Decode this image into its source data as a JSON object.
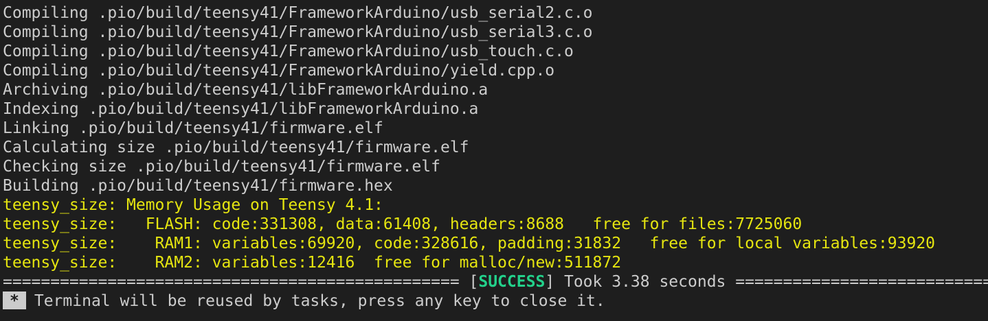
{
  "terminal": {
    "plain_lines": [
      "Compiling .pio/build/teensy41/FrameworkArduino/usb_serial2.c.o",
      "Compiling .pio/build/teensy41/FrameworkArduino/usb_serial3.c.o",
      "Compiling .pio/build/teensy41/FrameworkArduino/usb_touch.c.o",
      "Compiling .pio/build/teensy41/FrameworkArduino/yield.cpp.o",
      "Archiving .pio/build/teensy41/libFrameworkArduino.a",
      "Indexing .pio/build/teensy41/libFrameworkArduino.a",
      "Linking .pio/build/teensy41/firmware.elf",
      "Calculating size .pio/build/teensy41/firmware.elf",
      "Checking size .pio/build/teensy41/firmware.elf",
      "Building .pio/build/teensy41/firmware.hex"
    ],
    "size_lines": [
      "teensy_size: Memory Usage on Teensy 4.1:",
      "teensy_size:   FLASH: code:331308, data:61408, headers:8688   free for files:7725060",
      "teensy_size:    RAM1: variables:69920, code:328616, padding:31832   free for local variables:93920",
      "teensy_size:    RAM2: variables:12416  free for malloc/new:511872"
    ],
    "summary": {
      "left_rule": "================================================ [",
      "status": "SUCCESS",
      "right_text": "] Took 3.38 seconds ========================================"
    },
    "footer": {
      "star": "*",
      "message": "Terminal will be reused by tasks, press any key to close it."
    }
  },
  "colors": {
    "background": "#1e1e1e",
    "text": "#cccccc",
    "warning_yellow": "#e5e510",
    "success_green": "#23d18b"
  }
}
